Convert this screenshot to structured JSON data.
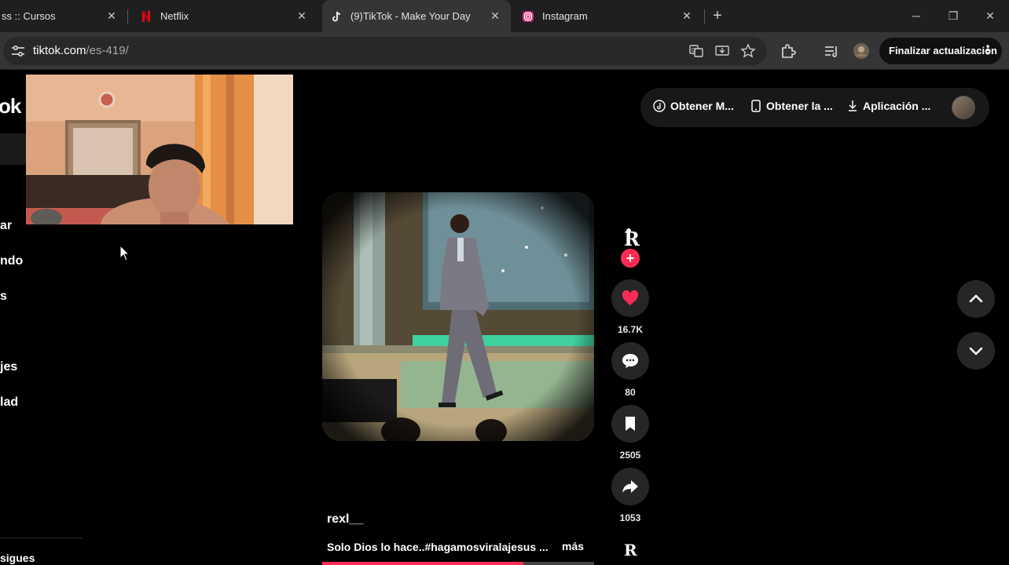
{
  "browser": {
    "tabs": [
      {
        "title": "ss :: Cursos",
        "active": false
      },
      {
        "title": "Netflix",
        "active": false
      },
      {
        "title": "(9)TikTok - Make Your Day",
        "active": true
      },
      {
        "title": "Instagram",
        "active": false
      }
    ],
    "new_tab_symbol": "+",
    "url_host": "tiktok.com",
    "url_path": "/es-419/",
    "update_button": "Finalizar actualización",
    "menu_symbol": "⋮"
  },
  "tiktok": {
    "logo_fragment": "ok",
    "sidebar": [
      "ar",
      "ndo",
      "s",
      "jes",
      "lad",
      "sigues"
    ],
    "top_actions": [
      "Obtener M...",
      "Obtener la ...",
      "Aplicación ..."
    ],
    "video": {
      "author": "rexl__",
      "caption": "Solo Dios lo hace..#hagamosviralajesus ...",
      "more_label": "más",
      "progress_fraction": 0.74
    },
    "actions": {
      "likes": "16.7K",
      "comments": "80",
      "saves": "2505",
      "shares": "1053"
    },
    "follow_symbol": "+"
  },
  "colors": {
    "tiktok_red": "#fe2c55",
    "tab_bar": "#1f1f1f",
    "active_tab": "#353535"
  },
  "icons": [
    "translate-icon",
    "install-app-icon",
    "bookmark-star-icon",
    "extensions-icon",
    "reading-list-icon",
    "profile-icon",
    "tiktok-icon",
    "download-icon",
    "phone-icon",
    "heart-icon",
    "comment-icon",
    "bookmark-icon",
    "share-icon",
    "chevron-up-icon",
    "chevron-down-icon"
  ]
}
